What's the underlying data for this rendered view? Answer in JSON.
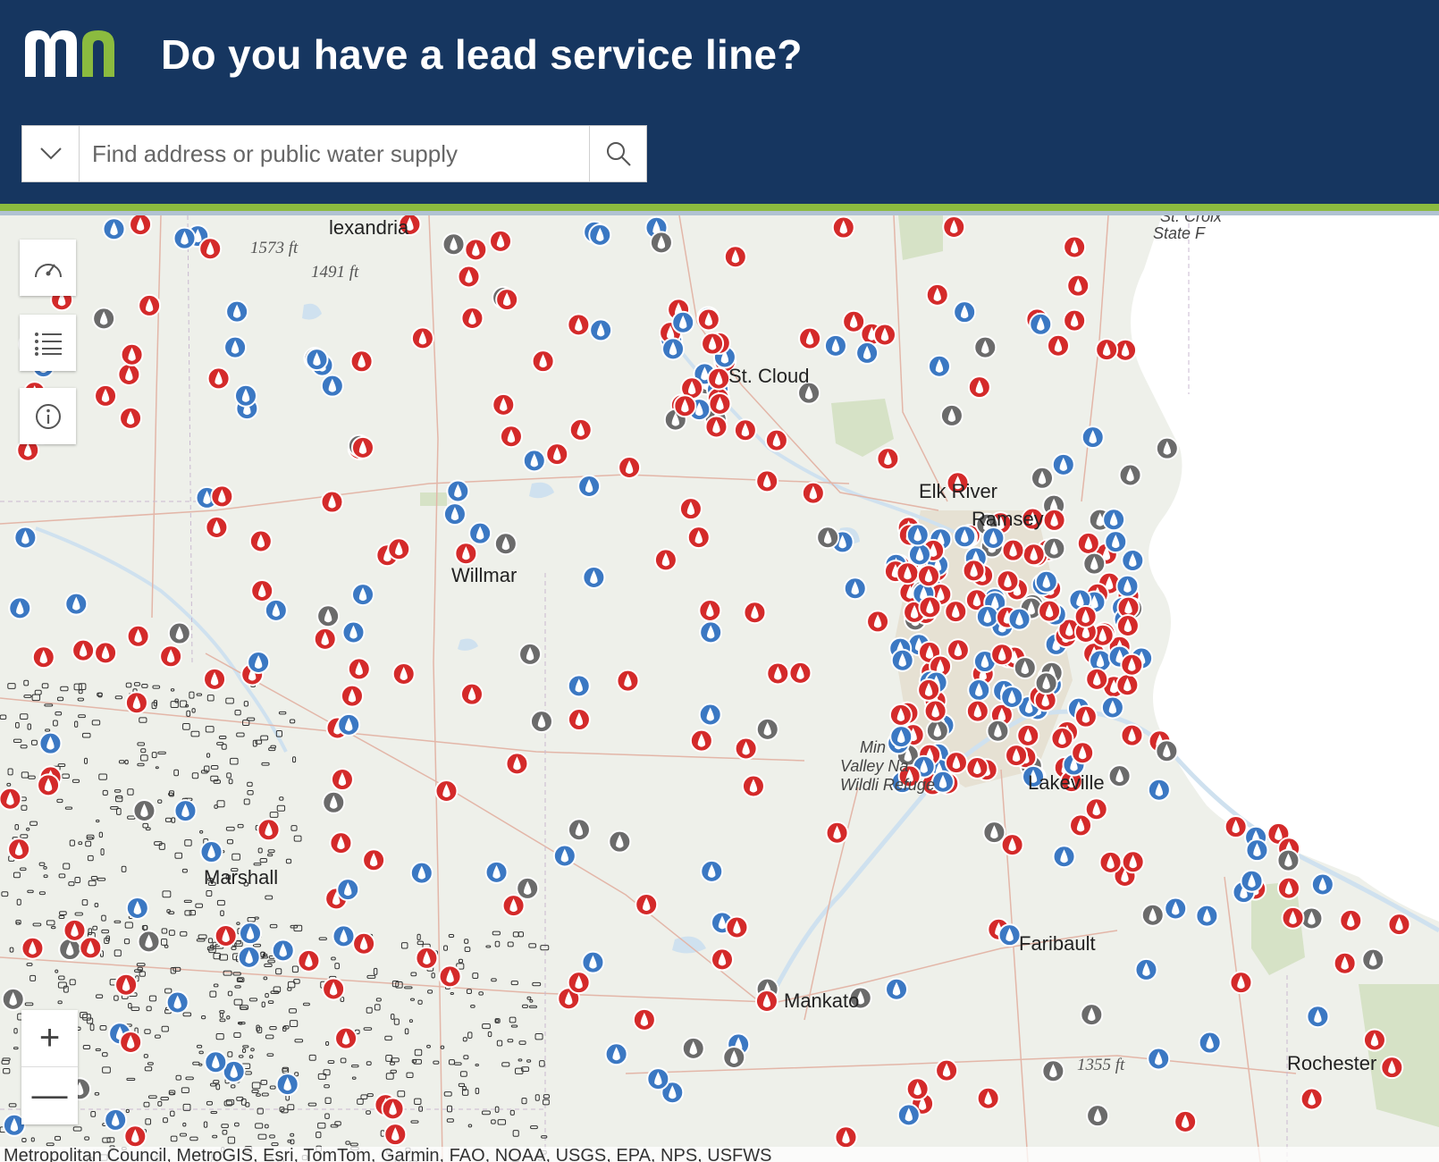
{
  "header": {
    "title": "Do you have a lead service line?",
    "logo_text": "mn"
  },
  "search": {
    "placeholder": "Find address or public water supply",
    "dropdown_icon": "chevron-down-icon",
    "search_icon": "search-icon"
  },
  "map_controls": {
    "basemap_icon": "gauge-icon",
    "legend_icon": "list-icon",
    "info_icon": "info-icon",
    "zoom_in": "+",
    "zoom_out": "—"
  },
  "places": {
    "alexandria": "lexandria",
    "elev1": "1573 ft",
    "elev2": "1491 ft",
    "st_cloud": "St. Cloud",
    "st_croix": "St. Croix",
    "state_f": "State F",
    "elk_river": "Elk River",
    "ramsey": "Ramsey",
    "willmar": "Willmar",
    "marshall": "Marshall",
    "mn_valley_1": "Min",
    "mn_valley_2": "Valley Na",
    "mn_valley_3": "Wildli  Refuge",
    "lakeville": "Lakeville",
    "faribault": "Faribault",
    "mankato": "Mankato",
    "rochester": "Rochester",
    "elev3": "1355 ft"
  },
  "attribution": "Metropolitan Council, MetroGIS, Esri, TomTom, Garmin, FAO, NOAA, USGS, EPA, NPS, USFWS",
  "colors": {
    "header_bg": "#163660",
    "accent_green": "#8bbb3f",
    "marker_red": "#d42a2a",
    "marker_blue": "#3b78c3",
    "marker_gray": "#6b6b6b",
    "water": "#cfe1ef",
    "park": "#d6e2c6"
  }
}
